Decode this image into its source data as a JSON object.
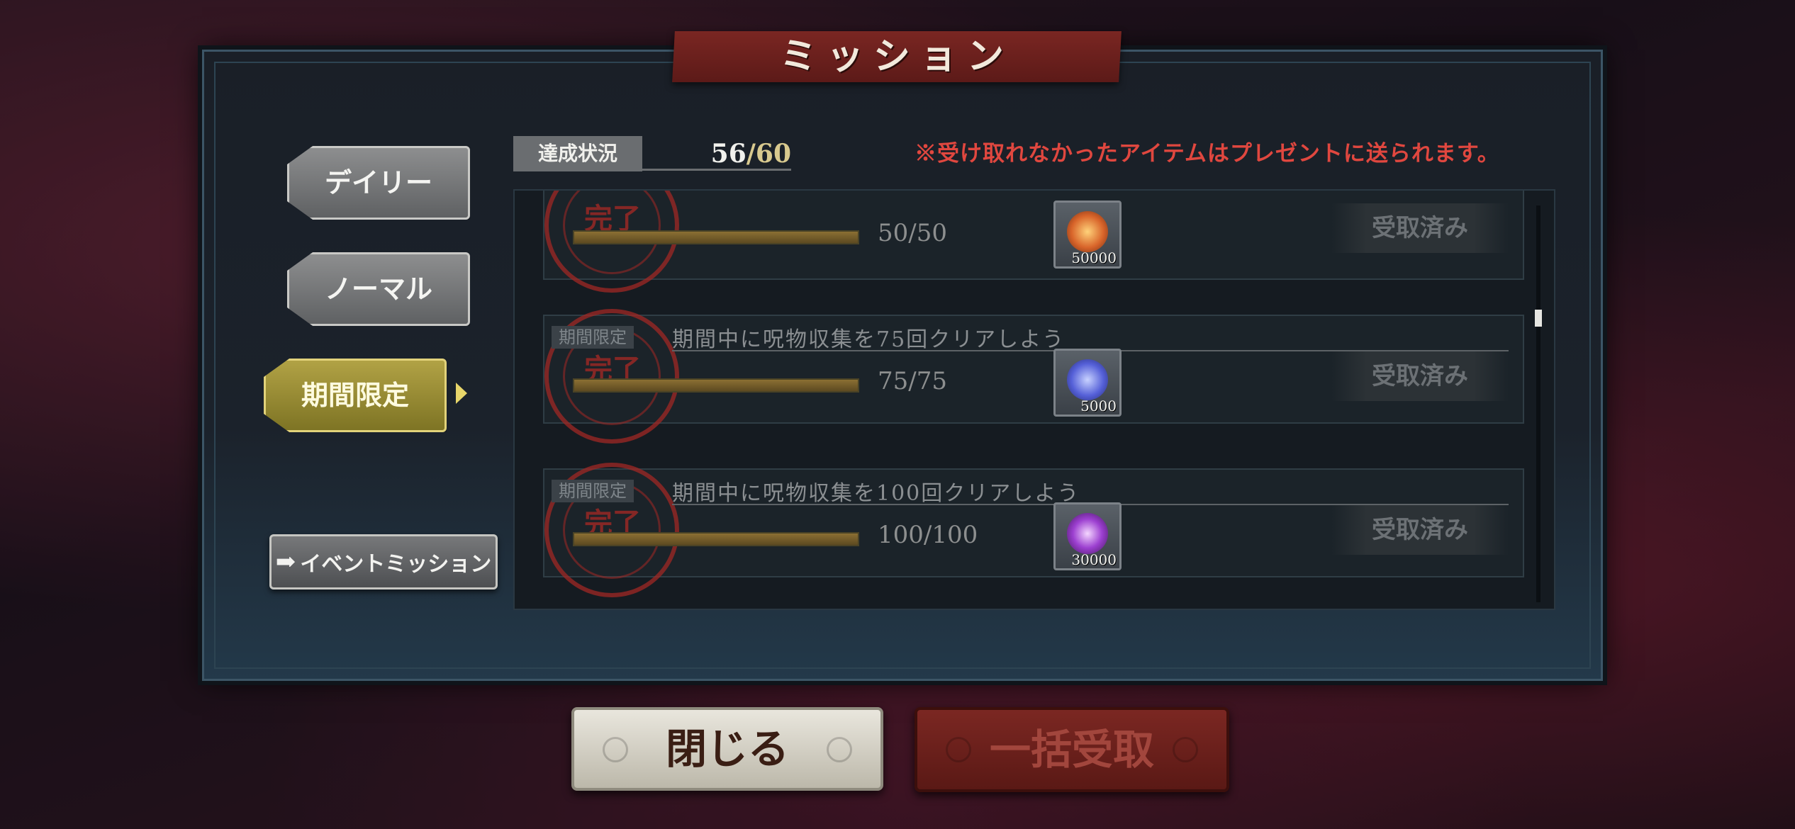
{
  "title": "ミッション",
  "tabs": [
    {
      "label": "デイリー",
      "active": false
    },
    {
      "label": "ノーマル",
      "active": false
    },
    {
      "label": "期間限定",
      "active": true
    }
  ],
  "event_button": {
    "label": "イベントミッション",
    "icon": "arrow-right-icon"
  },
  "status": {
    "label": "達成状況",
    "current": "56",
    "total": "/60"
  },
  "notice": "※受け取れなかったアイテムはプレゼントに送られます。",
  "missions": [
    {
      "label": "",
      "title": "",
      "progress_text": "50/50",
      "progress": 1.0,
      "reward_icon": "fire-orb-icon",
      "reward_qty": "50000",
      "button": "受取済み"
    },
    {
      "label": "期間限定",
      "title": "期間中に呪物収集を75回クリアしよう",
      "progress_text": "75/75",
      "progress": 1.0,
      "reward_icon": "blue-orb-icon",
      "reward_qty": "5000",
      "button": "受取済み"
    },
    {
      "label": "期間限定",
      "title": "期間中に呪物収集を100回クリアしよう",
      "progress_text": "100/100",
      "progress": 1.0,
      "reward_icon": "purple-flame-icon",
      "reward_qty": "30000",
      "button": "受取済み"
    }
  ],
  "stamp_mark": "完了",
  "buttons": {
    "close": "閉じる",
    "bulk_claim": "一括受取"
  },
  "colors": {
    "accent_red": "#e0473f",
    "active_tab": "#b1a245",
    "progress_fill": "#8b6f33"
  }
}
